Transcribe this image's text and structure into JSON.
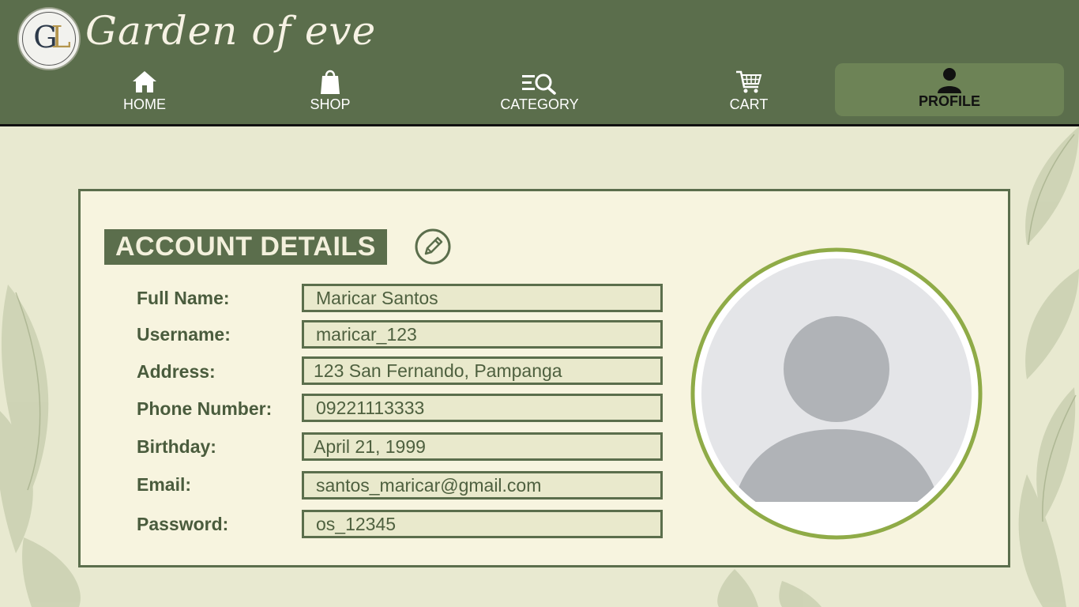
{
  "brand": {
    "name": "Garden of eve",
    "logo_monogram": "GL",
    "logo_ring_text": "GARDEN OF EVE"
  },
  "nav": {
    "home": {
      "label": "HOME",
      "icon": "home-icon"
    },
    "shop": {
      "label": "SHOP",
      "icon": "shopping-bag-icon"
    },
    "category": {
      "label": "CATEGORY",
      "icon": "search-list-icon"
    },
    "cart": {
      "label": "CART",
      "icon": "cart-icon"
    },
    "profile": {
      "label": "PROFILE",
      "icon": "user-icon",
      "active": true
    }
  },
  "account": {
    "title": "ACCOUNT DETAILS",
    "edit_icon": "edit-pencil-icon",
    "fields": [
      {
        "label": "Full Name:",
        "value": "Maricar Santos"
      },
      {
        "label": "Username:",
        "value": "maricar_123"
      },
      {
        "label": "Address:",
        "value": "123 San Fernando, Pampanga"
      },
      {
        "label": "Phone Number:",
        "value": "09221113333"
      },
      {
        "label": "Birthday:",
        "value": "April 21, 1999"
      },
      {
        "label": "Email:",
        "value": "santos_maricar@gmail.com"
      },
      {
        "label": "Password:",
        "value": "os_12345"
      }
    ],
    "avatar_icon": "avatar-placeholder-icon"
  },
  "colors": {
    "header": "#5b6e4c",
    "active_tab": "#6d8356",
    "page_bg": "#e8e9d0",
    "card_bg": "#f7f4df",
    "field_bg": "#e9e9cc",
    "avatar_ring": "#8fab47"
  }
}
